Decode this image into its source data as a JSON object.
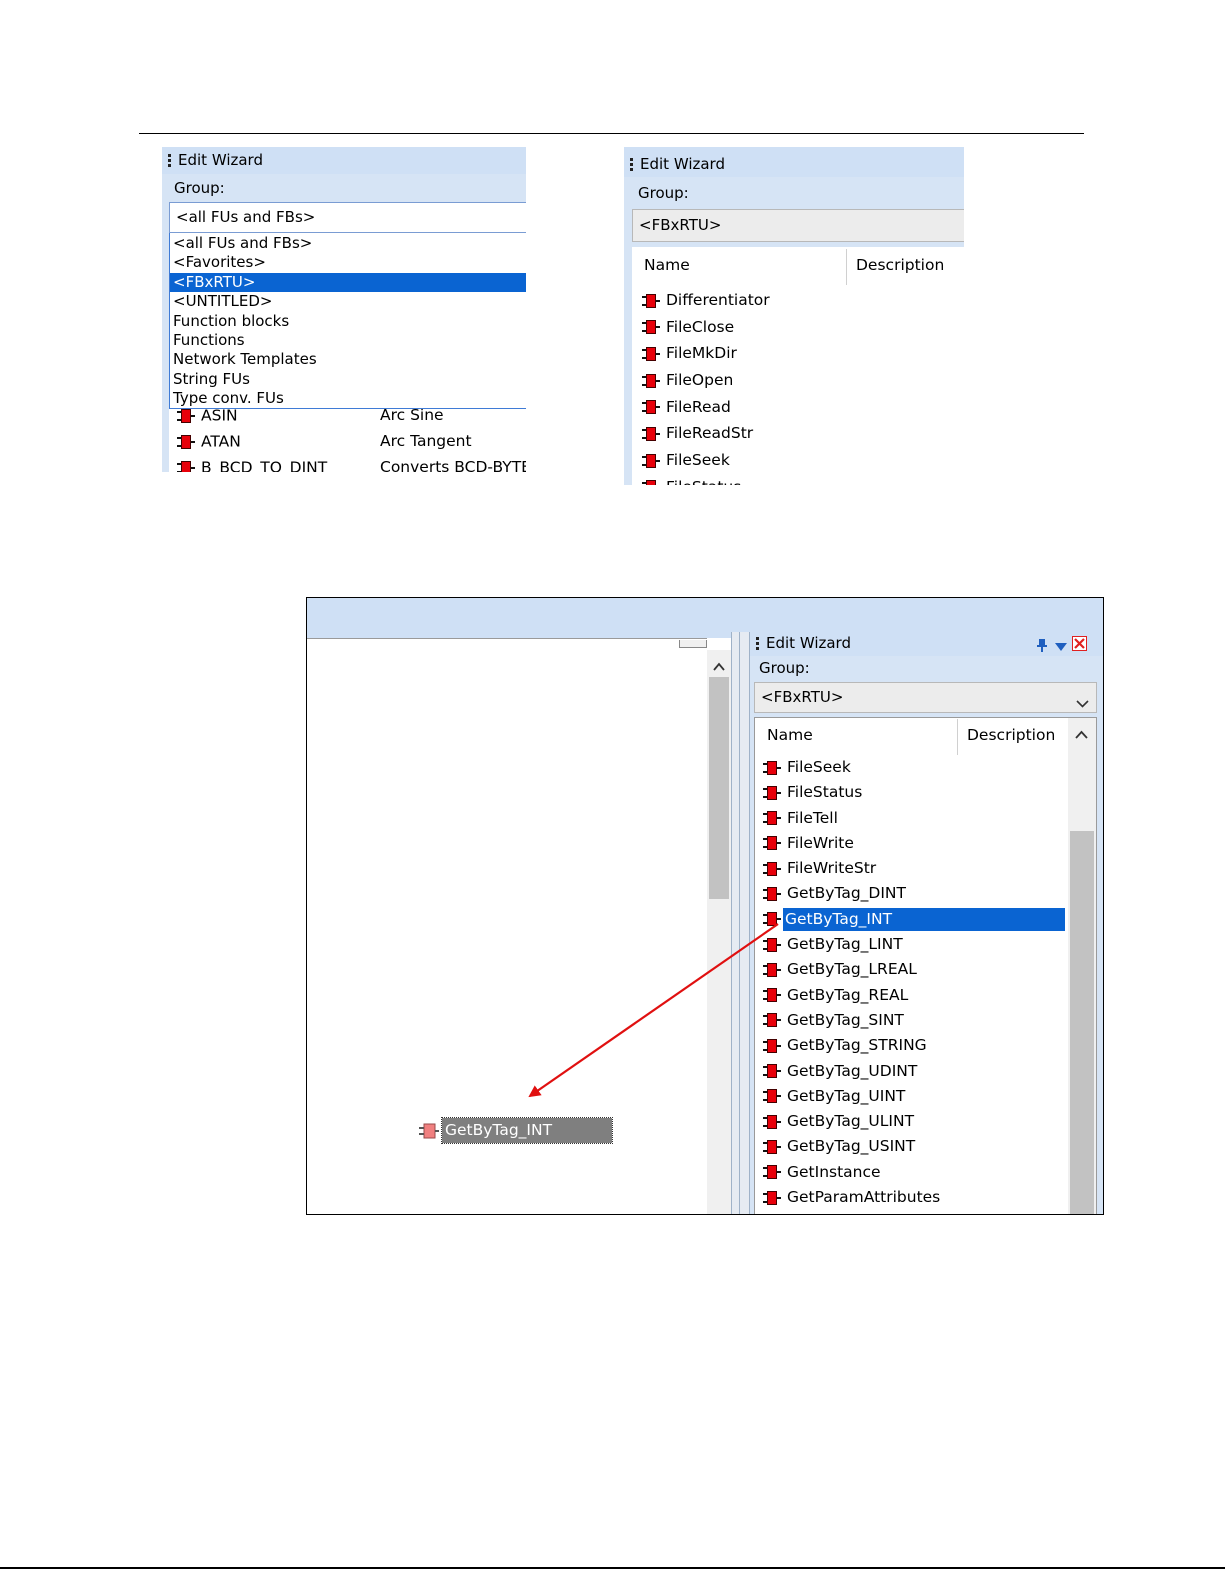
{
  "shot1": {
    "title": "Edit Wizard",
    "group_label": "Group:",
    "combo_value": "<all FUs and FBs>",
    "dropdown_items": [
      {
        "label": "<all FUs and FBs>",
        "selected": false
      },
      {
        "label": "<Favorites>",
        "selected": false
      },
      {
        "label": "<FBxRTU>",
        "selected": true
      },
      {
        "label": "<UNTITLED>",
        "selected": false
      },
      {
        "label": "Function blocks",
        "selected": false
      },
      {
        "label": "Functions",
        "selected": false
      },
      {
        "label": "Network Templates",
        "selected": false
      },
      {
        "label": "String FUs",
        "selected": false
      },
      {
        "label": "Type conv. FUs",
        "selected": false
      }
    ],
    "rows": [
      {
        "name": "ASIN",
        "desc": "Arc Sine"
      },
      {
        "name": "ATAN",
        "desc": "Arc Tangent"
      },
      {
        "name": "B_BCD_TO_DINT",
        "desc": "Converts BCD-BYTE"
      }
    ]
  },
  "shot2": {
    "title": "Edit Wizard",
    "group_label": "Group:",
    "combo_value": "<FBxRTU>",
    "col_name": "Name",
    "col_desc": "Description",
    "items": [
      "Differentiator",
      "FileClose",
      "FileMkDir",
      "FileOpen",
      "FileRead",
      "FileReadStr",
      "FileSeek",
      "FileStatus"
    ]
  },
  "shot3": {
    "title": "Edit Wizard",
    "group_label": "Group:",
    "combo_value": "<FBxRTU>",
    "col_name": "Name",
    "col_desc": "Description",
    "items": [
      "FileSeek",
      "FileStatus",
      "FileTell",
      "FileWrite",
      "FileWriteStr",
      "GetByTag_DINT",
      "GetByTag_INT",
      "GetByTag_LINT",
      "GetByTag_LREAL",
      "GetByTag_REAL",
      "GetByTag_SINT",
      "GetByTag_STRING",
      "GetByTag_UDINT",
      "GetByTag_UINT",
      "GetByTag_ULINT",
      "GetByTag_USINT",
      "GetInstance",
      "GetParamAttributes"
    ],
    "selected_item": "GetByTag_INT",
    "placed_block": "GetByTag_INT",
    "icons": [
      "pin-icon",
      "dropdown-arrow-icon",
      "close-icon",
      "scroll-up-icon",
      "chevron-down-icon"
    ],
    "colors": {
      "selection": "#0a64d2",
      "arrow": "#e01010",
      "close": "#e02020",
      "title_bar": "#cfe0f5"
    }
  }
}
